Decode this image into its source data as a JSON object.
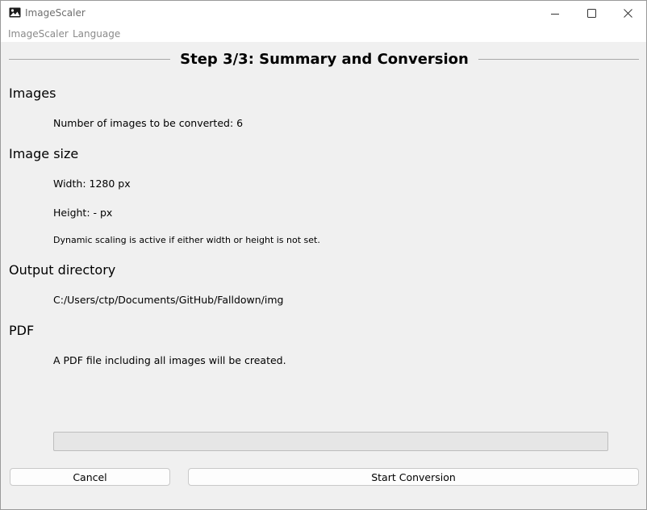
{
  "window": {
    "title": "ImageScaler"
  },
  "menubar": {
    "items": [
      "ImageScaler",
      "Language"
    ]
  },
  "step": {
    "title": "Step 3/3: Summary and Conversion"
  },
  "sections": {
    "images": {
      "title": "Images",
      "count_text": "Number of images to be converted: 6"
    },
    "image_size": {
      "title": "Image size",
      "width_text": "Width: 1280 px",
      "height_text": "Height: - px",
      "note": "Dynamic scaling is active if either width or height is not set."
    },
    "output": {
      "title": "Output directory",
      "path": "C:/Users/ctp/Documents/GitHub/Falldown/img"
    },
    "pdf": {
      "title": "PDF",
      "text": "A PDF file including all images will be created."
    }
  },
  "progress": {
    "value": 0
  },
  "buttons": {
    "cancel": "Cancel",
    "start": "Start Conversion"
  },
  "icons": {
    "app": "image-icon",
    "minimize": "minimize-icon",
    "maximize": "maximize-icon",
    "close": "close-icon"
  }
}
